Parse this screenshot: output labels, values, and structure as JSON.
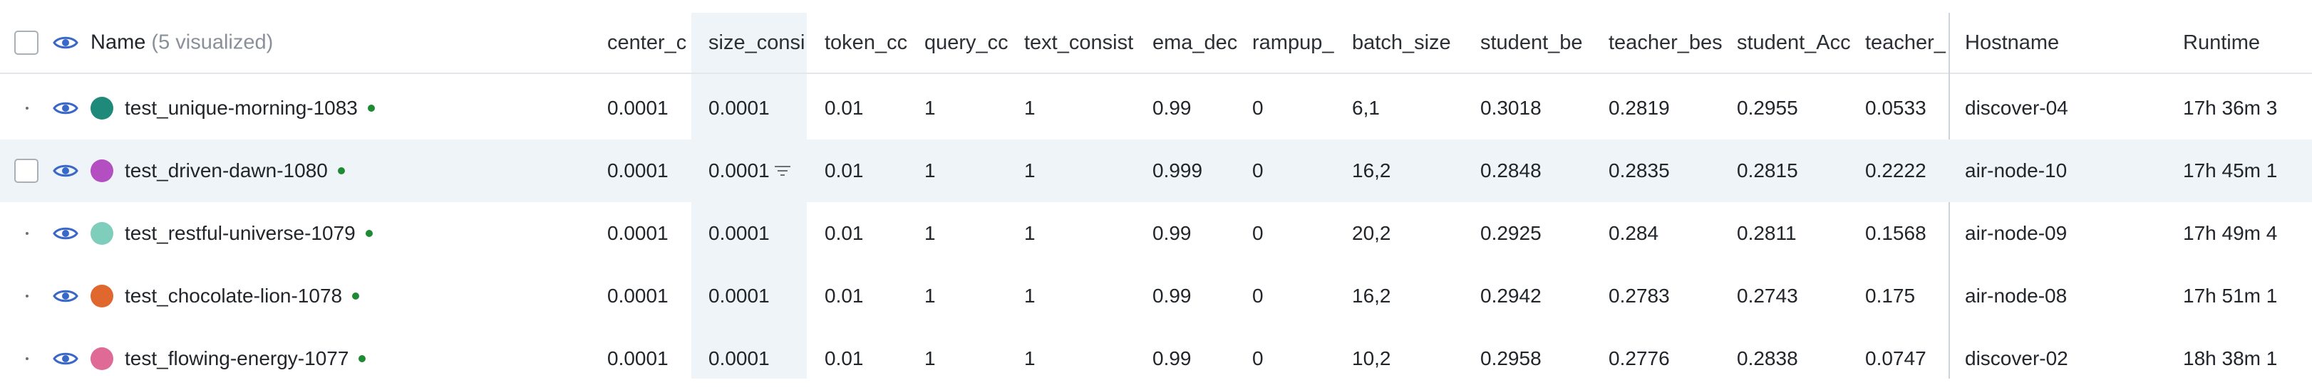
{
  "header": {
    "name_label": "Name",
    "name_count": "(5 visualized)",
    "columns": [
      {
        "key": "center",
        "label": "center_c"
      },
      {
        "key": "size",
        "label": "size_consi"
      },
      {
        "key": "token",
        "label": "token_cc"
      },
      {
        "key": "query",
        "label": "query_cc"
      },
      {
        "key": "text",
        "label": "text_consist"
      },
      {
        "key": "ema",
        "label": "ema_dec"
      },
      {
        "key": "rampup",
        "label": "rampup_"
      },
      {
        "key": "batch",
        "label": "batch_size"
      },
      {
        "key": "student_be",
        "label": "student_be"
      },
      {
        "key": "teacher_be",
        "label": "teacher_bes"
      },
      {
        "key": "student_acc",
        "label": "student_Acc"
      },
      {
        "key": "teacher_x",
        "label": "teacher_"
      },
      {
        "key": "hostname",
        "label": "Hostname"
      },
      {
        "key": "runtime",
        "label": "Runtime"
      }
    ]
  },
  "colors": {
    "status_running": "#1e8a32",
    "highlight": "#eef4f8"
  },
  "rows": [
    {
      "name": "test_unique-morning-1083",
      "color": "#1f8a7a",
      "cells": [
        "0.0001",
        "0.0001",
        "0.01",
        "1",
        "1",
        "0.99",
        "0",
        "6,1",
        "0.3018",
        "0.2819",
        "0.2955",
        "0.0533",
        "discover-04",
        "17h 36m 3"
      ]
    },
    {
      "name": "test_driven-dawn-1080",
      "color": "#b44fc2",
      "cells": [
        "0.0001",
        "0.0001",
        "0.01",
        "1",
        "1",
        "0.999",
        "0",
        "16,2",
        "0.2848",
        "0.2835",
        "0.2815",
        "0.2222",
        "air-node-10",
        "17h 45m 1"
      ]
    },
    {
      "name": "test_restful-universe-1079",
      "color": "#7fcdbb",
      "cells": [
        "0.0001",
        "0.0001",
        "0.01",
        "1",
        "1",
        "0.99",
        "0",
        "20,2",
        "0.2925",
        "0.284",
        "0.2811",
        "0.1568",
        "air-node-09",
        "17h 49m 4"
      ]
    },
    {
      "name": "test_chocolate-lion-1078",
      "color": "#e0682f",
      "cells": [
        "0.0001",
        "0.0001",
        "0.01",
        "1",
        "1",
        "0.99",
        "0",
        "16,2",
        "0.2942",
        "0.2783",
        "0.2743",
        "0.175",
        "air-node-08",
        "17h 51m 1"
      ]
    },
    {
      "name": "test_flowing-energy-1077",
      "color": "#e06a96",
      "cells": [
        "0.0001",
        "0.0001",
        "0.01",
        "1",
        "1",
        "0.99",
        "0",
        "10,2",
        "0.2958",
        "0.2776",
        "0.2838",
        "0.0747",
        "discover-02",
        "18h 38m 1"
      ]
    }
  ]
}
